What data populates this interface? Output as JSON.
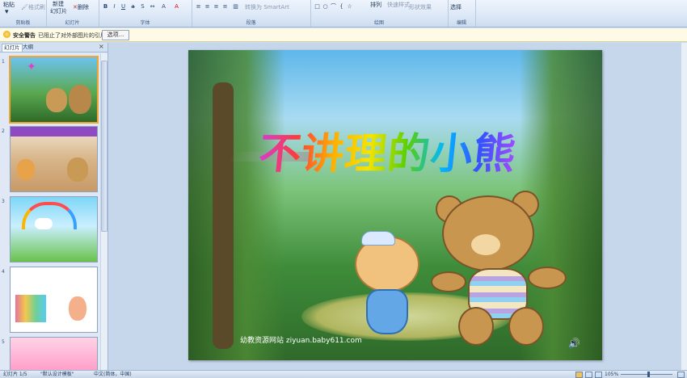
{
  "ribbon": {
    "paste": "粘贴",
    "format_painter": "格式刷",
    "new_slide_line1": "新建",
    "new_slide_line2": "幻灯片",
    "delete": "删除",
    "convert_smartart": "转换为 SmartArt",
    "arrange": "排列",
    "quick_styles": "快速样式",
    "shape_effects": "形状效果",
    "select": "选择",
    "groups": [
      "剪贴板",
      "幻灯片",
      "字体",
      "段落",
      "绘图",
      "编辑"
    ]
  },
  "security": {
    "title": "安全警告",
    "message": "已阻止了对外部图片的引用",
    "options_button": "选项..."
  },
  "panel": {
    "tab_slides": "幻灯片",
    "tab_outline": "大纲",
    "close": "×",
    "thumb_numbers": [
      "1",
      "2",
      "3",
      "4",
      "5"
    ]
  },
  "slide": {
    "title": "不讲理的小熊",
    "footer": "幼教资源网站  ziyuan.baby611.com"
  },
  "status": {
    "slide_count": "幻灯片 1/5",
    "theme": "\"默认设计模板\"",
    "language": "中文(简体，中国)",
    "zoom": "105%"
  },
  "colors": {
    "ribbon_bg": "#dce8f7",
    "selection_border": "#f0a630",
    "workspace_bg": "#c6d7ec"
  }
}
